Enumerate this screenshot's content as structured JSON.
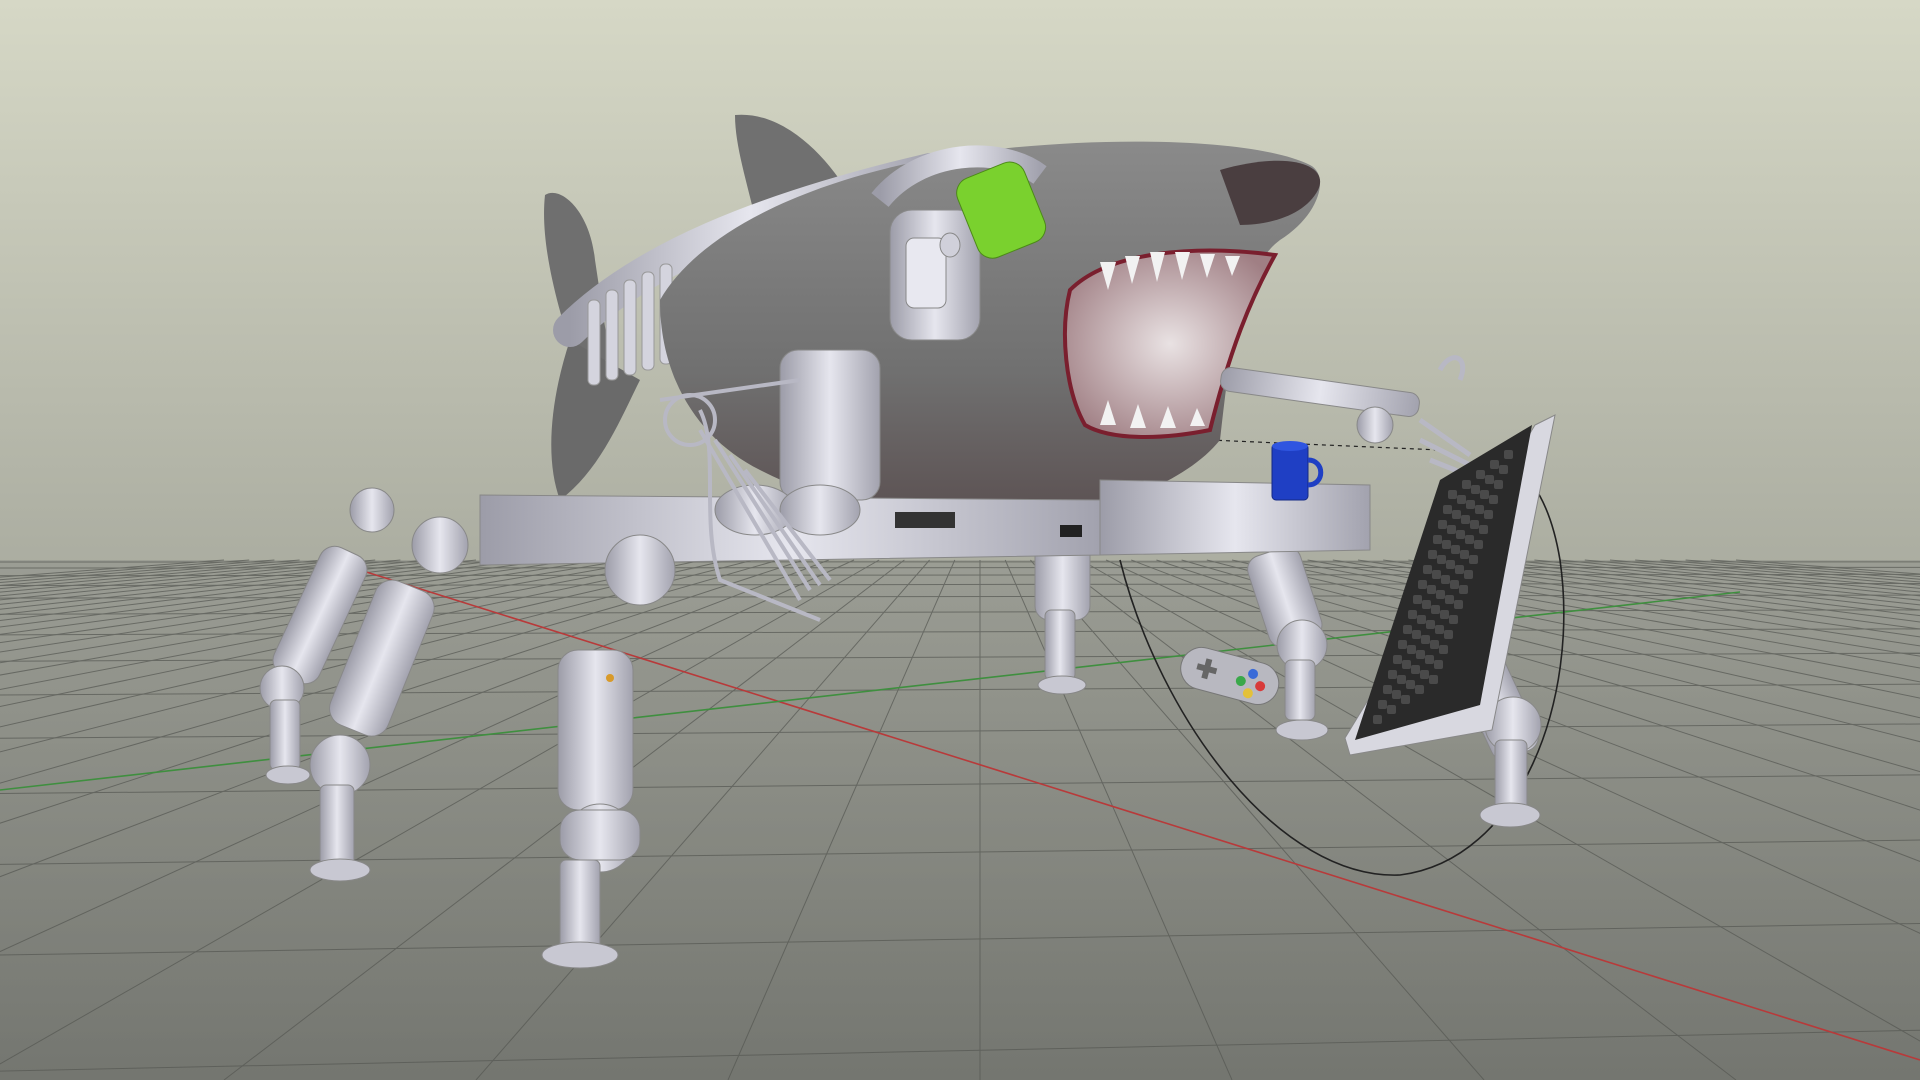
{
  "viewport": {
    "type": "3d-viewport",
    "view": "perspective",
    "shading": "solid",
    "background_colors": {
      "top": "#d6d8c6",
      "bottom": "#8d8f88"
    },
    "floor_color": "#6e706b",
    "grid_line_color": "#555752",
    "axis_colors": {
      "x_axis": "#b83a3a",
      "y_axis": "#3f8f3f"
    },
    "grid": true
  },
  "scene": {
    "objects": [
      {
        "name": "shark-body",
        "color": "#7a7a7a"
      },
      {
        "name": "mechanical-spine",
        "color": "#c8c8d2"
      },
      {
        "name": "headphones",
        "color": "#c8c8d2"
      },
      {
        "name": "green-ear-pad",
        "color": "#7ad12e"
      },
      {
        "name": "blue-mug",
        "color": "#1f3fc4"
      },
      {
        "name": "keyboard-panel",
        "color": "#2a2a2a"
      },
      {
        "name": "game-controller",
        "color": "#b8b8c0"
      },
      {
        "name": "robot-legs",
        "count": 7,
        "color": "#c6c6d0"
      },
      {
        "name": "robot-arms",
        "count": 2,
        "color": "#c6c6d0"
      },
      {
        "name": "cable-curve",
        "color": "#222222"
      }
    ]
  }
}
